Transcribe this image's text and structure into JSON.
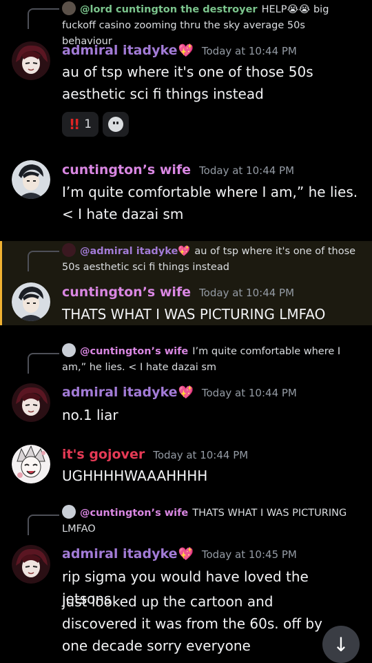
{
  "colors": {
    "admiral": "#a27bd6",
    "cuntington_wife": "#d987e2",
    "gojover": "#e53a55",
    "lord": "#7bc48c",
    "highlight_border": "#f0b232"
  },
  "messages": [
    {
      "reply": {
        "author": "@lord cuntington the destroyer",
        "text": "HELP😭😭 big fuckoff casino zooming thru the sky average 50s behaviour"
      },
      "author": "admiral itadyke",
      "heart": "💖",
      "timestamp": "Today at 10:44 PM",
      "body": "au of tsp where it's one of those 50s aesthetic sci fi things instead",
      "reactions": [
        {
          "emoji": "‼️",
          "count": "1"
        }
      ]
    },
    {
      "author": "cuntington’s wife",
      "timestamp": "Today at 10:44 PM",
      "body": "I’m quite comfortable where I am,” he lies. < I hate dazai sm"
    },
    {
      "reply": {
        "author": "@admiral itadyke💖",
        "text": "au of tsp where it's one of those 50s aesthetic sci fi things instead"
      },
      "author": "cuntington’s wife",
      "timestamp": "Today at 10:44 PM",
      "body": "THATS WHAT I WAS PICTURING LMFAO"
    },
    {
      "reply": {
        "author": "@cuntington’s wife",
        "text": "I’m quite comfortable where I am,” he lies. < I hate dazai sm"
      },
      "author": "admiral itadyke",
      "heart": "💖",
      "timestamp": "Today at 10:44 PM",
      "body": "no.1 liar"
    },
    {
      "author": "it's gojover",
      "timestamp": "Today at 10:44 PM",
      "body": "UGHHHHWAAAHHHH"
    },
    {
      "reply": {
        "author": "@cuntington’s wife",
        "text": "THATS WHAT I WAS PICTURING LMFAO"
      },
      "author": "admiral itadyke",
      "heart": "💖",
      "timestamp": "Today at 10:45 PM",
      "body": "rip sigma you would have loved the jetsons",
      "body2": "just looked up the cartoon and discovered it was from the 60s. off by one decade sorry everyone"
    }
  ],
  "scroll_button": {
    "icon": "arrow-down-icon",
    "glyph": "↓"
  }
}
